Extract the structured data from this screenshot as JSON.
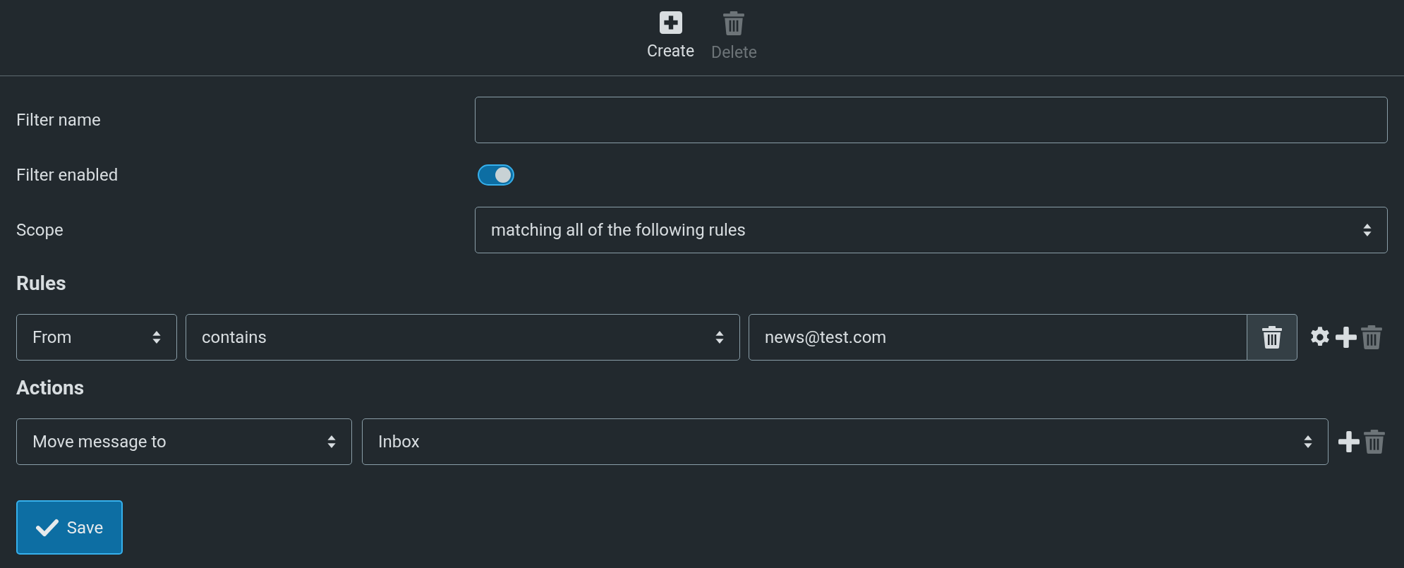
{
  "toolbar": [
    {
      "kind": "create",
      "label": "Create",
      "disabled": false
    },
    {
      "kind": "delete",
      "label": "Delete",
      "disabled": true
    }
  ],
  "form": {
    "filter_name": {
      "label": "Filter name"
    },
    "filter_enabled": {
      "label": "Filter enabled",
      "on": true
    },
    "scope": {
      "label": "Scope",
      "value": "matching all of the following rules"
    }
  },
  "rules": {
    "heading": "Rules",
    "items": [
      {
        "field": "From",
        "operator": "contains",
        "value": "news@test.com",
        "delete_disabled": true
      }
    ]
  },
  "actions": {
    "heading": "Actions",
    "items": [
      {
        "action": "Move message to",
        "target": "Inbox",
        "delete_disabled": true
      }
    ]
  },
  "save_button": {
    "label": "Save"
  }
}
